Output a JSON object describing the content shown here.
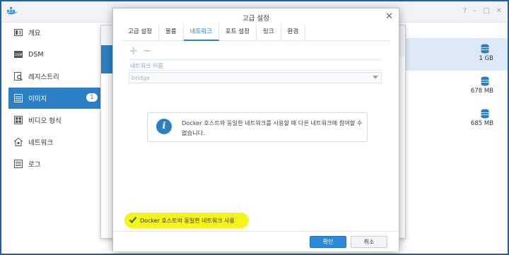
{
  "window": {
    "controls": [
      "?",
      "–",
      "□",
      "✕"
    ]
  },
  "sidebar": {
    "items": [
      {
        "label": "개요",
        "icon": "overview-icon"
      },
      {
        "label": "DSM",
        "icon": "dsm-icon"
      },
      {
        "label": "레지스트리",
        "icon": "registry-icon"
      },
      {
        "label": "이미지",
        "icon": "image-icon",
        "badge": "1",
        "active": true
      },
      {
        "label": "비디오 형식",
        "icon": "video-format-icon"
      },
      {
        "label": "네트워크",
        "icon": "network-icon"
      },
      {
        "label": "로그",
        "icon": "log-icon"
      }
    ]
  },
  "images": [
    {
      "size": "1 GB",
      "selected": true
    },
    {
      "size": "678 MB",
      "selected": false
    },
    {
      "size": "685 MB",
      "selected": false
    }
  ],
  "dialog": {
    "title": "고급 설정",
    "tabs": [
      "고급 설정",
      "볼륨",
      "네트워크",
      "포트 설정",
      "링크",
      "환경"
    ],
    "active_tab": "네트워크",
    "network_header": "네트워크 이름",
    "network_value": "bridge",
    "info_message": "Docker 호스트와 동일한 네트워크를 사용할 때 다른 네트워크에 참여할 수 없습니다.",
    "checkbox_label": "Docker 호스트와 동일한 네트워크 사용",
    "checkbox_checked": true,
    "ok_label": "확인",
    "cancel_label": "취소"
  },
  "colors": {
    "accent": "#2b80c5",
    "highlight": "#f6f41a"
  }
}
